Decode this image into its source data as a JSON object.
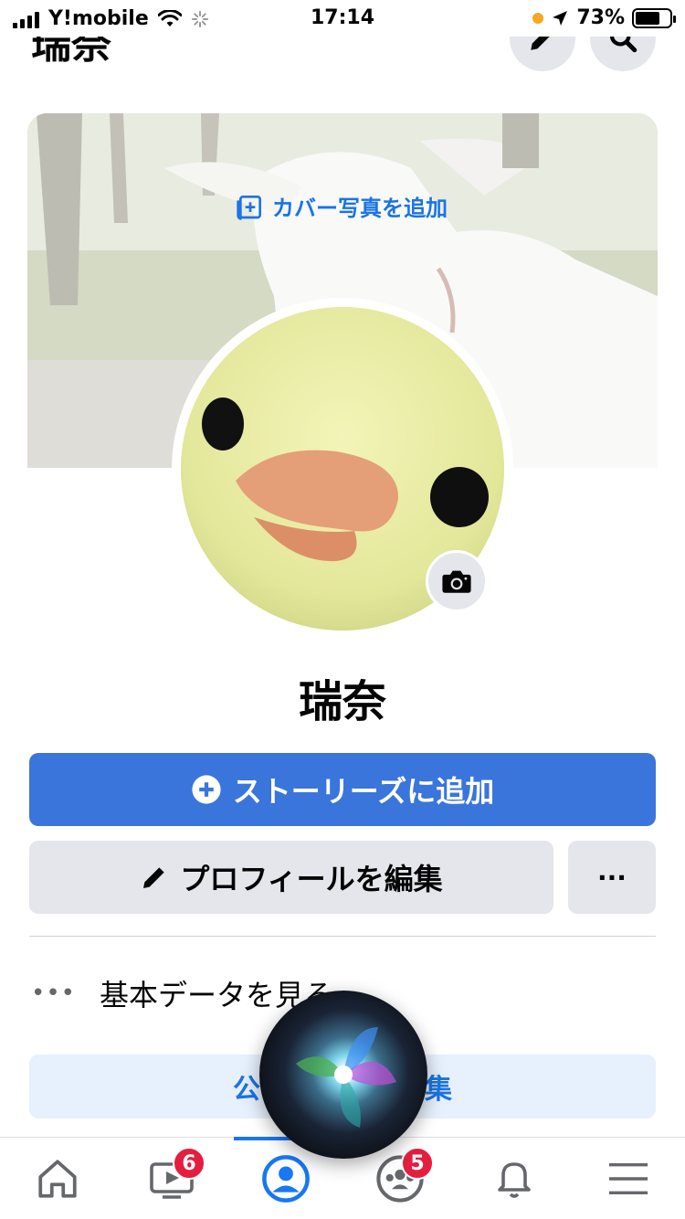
{
  "status_bar": {
    "carrier": "Y!mobile",
    "time": "17:14",
    "battery_pct": "73%",
    "battery_level": 0.73
  },
  "header": {
    "title": "瑞奈"
  },
  "cover": {
    "add_cover_label": "カバー写真を追加"
  },
  "profile": {
    "name": "瑞奈"
  },
  "actions": {
    "add_story_label": "ストーリーズに追加",
    "edit_profile_label": "プロフィールを編集",
    "more_label": "···"
  },
  "about": {
    "label": "基本データを見る"
  },
  "public_edit": {
    "label_left": "公",
    "label_right": "集"
  },
  "tabs": {
    "items": [
      {
        "name": "home-icon",
        "badge": ""
      },
      {
        "name": "watch-icon",
        "badge": "6"
      },
      {
        "name": "profile-icon",
        "badge": ""
      },
      {
        "name": "groups-icon",
        "badge": "5"
      },
      {
        "name": "bell-icon",
        "badge": ""
      },
      {
        "name": "menu-icon",
        "badge": ""
      }
    ],
    "active_index": 2
  },
  "colors": {
    "primary": "#3a75dc",
    "link": "#1b74e4",
    "badge": "#e41e3f",
    "button_gray": "#e4e6eb"
  }
}
